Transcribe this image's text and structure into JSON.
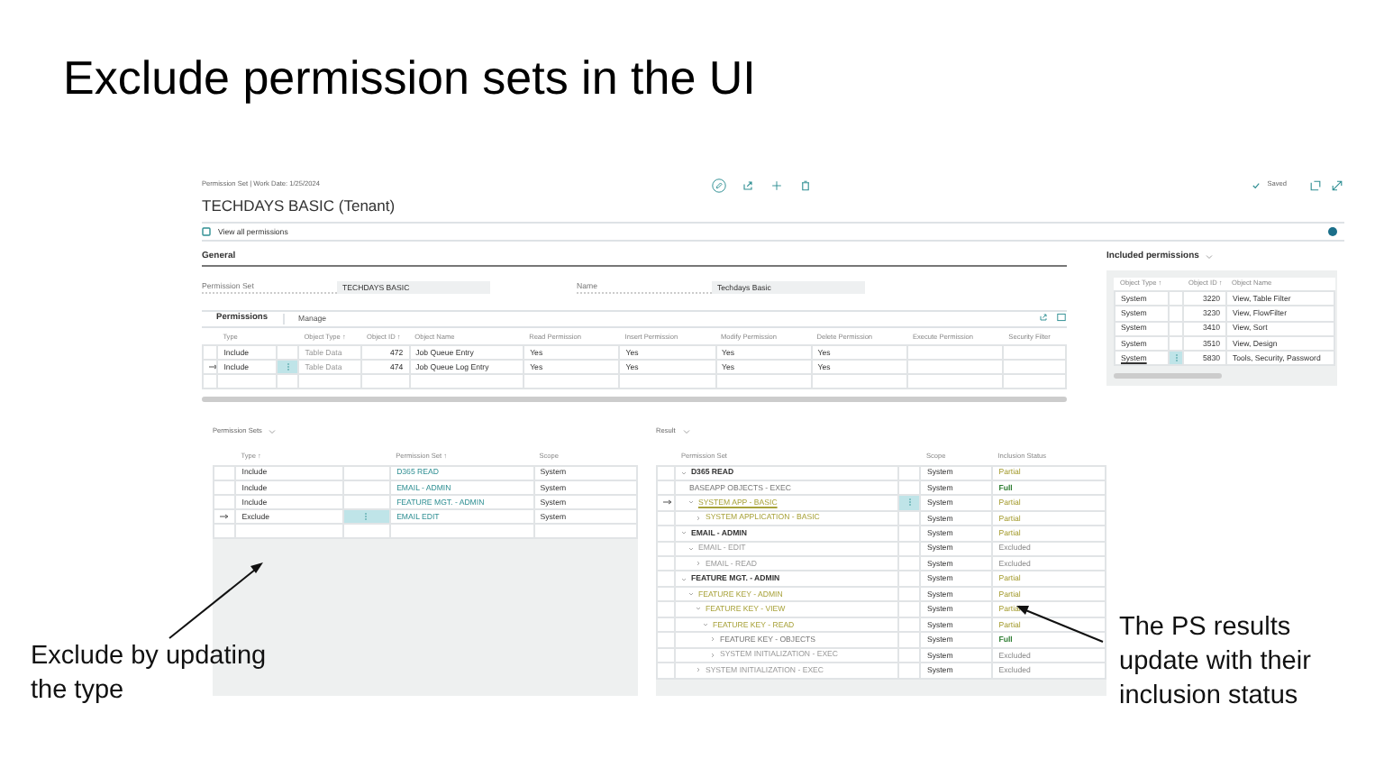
{
  "slide_title": "Exclude permission sets in the UI",
  "app": {
    "breadcrumb": "Permission Set | Work Date: 1/25/2024",
    "record_title": "TECHDAYS BASIC (Tenant)",
    "saved": "Saved",
    "view_all": "View all permissions"
  },
  "general": {
    "heading": "General",
    "fields": [
      {
        "label": "Permission Set",
        "value": "TECHDAYS BASIC"
      },
      {
        "label": "Name",
        "value": "Techdays Basic"
      }
    ]
  },
  "permissions": {
    "tabs": [
      {
        "label": "Permissions",
        "selected": true
      },
      {
        "label": "Manage",
        "selected": false
      }
    ],
    "columns": [
      "Type",
      "",
      "Object Type ↑",
      "Object ID ↑",
      "Object Name",
      "Read Permission",
      "Insert Permission",
      "Modify Permission",
      "Delete Permission",
      "Execute Permission",
      "Security Filter"
    ],
    "rows": [
      {
        "selected": false,
        "cells": [
          "Include",
          "",
          "Table Data",
          "472",
          "Job Queue Entry",
          "Yes",
          "Yes",
          "Yes",
          "Yes",
          "",
          ""
        ]
      },
      {
        "selected": true,
        "cells": [
          "Include",
          "",
          "Table Data",
          "474",
          "Job Queue Log Entry",
          "Yes",
          "Yes",
          "Yes",
          "Yes",
          "",
          ""
        ]
      }
    ]
  },
  "included_permissions": {
    "title": "Included permissions",
    "columns": [
      "Object Type ↑",
      "Object ID ↑",
      "Object Name"
    ],
    "rows": [
      {
        "selected": false,
        "cells": [
          "System",
          "3220",
          "View, Table Filter"
        ]
      },
      {
        "selected": false,
        "cells": [
          "System",
          "3230",
          "View, FlowFilter"
        ]
      },
      {
        "selected": false,
        "cells": [
          "System",
          "3410",
          "View, Sort"
        ]
      },
      {
        "selected": false,
        "cells": [
          "System",
          "3510",
          "View, Design"
        ]
      },
      {
        "selected": true,
        "cells": [
          "System",
          "5830",
          "Tools, Security, Password"
        ]
      }
    ]
  },
  "permission_sets": {
    "title": "Permission Sets",
    "columns": [
      "Type ↑",
      "Permission Set ↑",
      "Scope"
    ],
    "rows": [
      {
        "selected": false,
        "type": "Include",
        "permission_set": "D365 READ",
        "scope": "System"
      },
      {
        "selected": false,
        "type": "Include",
        "permission_set": "EMAIL - ADMIN",
        "scope": "System"
      },
      {
        "selected": false,
        "type": "Include",
        "permission_set": "FEATURE MGT. - ADMIN",
        "scope": "System"
      },
      {
        "selected": true,
        "type": "Exclude",
        "permission_set": "EMAIL EDIT",
        "scope": "System"
      }
    ]
  },
  "result": {
    "title": "Result",
    "columns": [
      "Permission Set",
      "Scope",
      "Inclusion Status"
    ],
    "rows": [
      {
        "name": "D365 READ",
        "scope": "System",
        "status": "Partial",
        "kind": "partial",
        "expanded": true,
        "selected": false,
        "children": [
          {
            "name": "BASEAPP OBJECTS - EXEC",
            "scope": "System",
            "status": "Full",
            "kind": "full",
            "selected": false
          },
          {
            "name": "SYSTEM APP - BASIC",
            "scope": "System",
            "status": "Partial",
            "kind": "partial",
            "expanded": true,
            "selected": true,
            "children": [
              {
                "name": "SYSTEM APPLICATION - BASIC",
                "scope": "System",
                "status": "Partial",
                "kind": "partial",
                "expanded": false,
                "selected": false
              }
            ]
          }
        ]
      },
      {
        "name": "EMAIL - ADMIN",
        "scope": "System",
        "status": "Partial",
        "kind": "partial",
        "expanded": true,
        "selected": false,
        "children": [
          {
            "name": "EMAIL - EDIT",
            "scope": "System",
            "status": "Excluded",
            "kind": "excluded",
            "expanded": true,
            "selected": false,
            "children": [
              {
                "name": "EMAIL - READ",
                "scope": "System",
                "status": "Excluded",
                "kind": "excluded",
                "expanded": false,
                "selected": false
              }
            ]
          }
        ]
      },
      {
        "name": "FEATURE MGT. - ADMIN",
        "scope": "System",
        "status": "Partial",
        "kind": "partial",
        "expanded": true,
        "selected": false,
        "children": [
          {
            "name": "FEATURE KEY - ADMIN",
            "scope": "System",
            "status": "Partial",
            "kind": "partial",
            "expanded": true,
            "selected": false,
            "children": [
              {
                "name": "FEATURE KEY - VIEW",
                "scope": "System",
                "status": "Partial",
                "kind": "partial",
                "expanded": true,
                "selected": false,
                "children": [
                  {
                    "name": "FEATURE KEY - READ",
                    "scope": "System",
                    "status": "Partial",
                    "kind": "partial",
                    "expanded": true,
                    "selected": false,
                    "children": [
                      {
                        "name": "FEATURE KEY - OBJECTS",
                        "scope": "System",
                        "status": "Full",
                        "kind": "full",
                        "expanded": false,
                        "selected": false
                      },
                      {
                        "name": "SYSTEM INITIALIZATION - EXEC",
                        "scope": "System",
                        "status": "Excluded",
                        "kind": "excluded",
                        "expanded": false,
                        "selected": false
                      }
                    ]
                  }
                ]
              },
              {
                "name": "SYSTEM INITIALIZATION - EXEC",
                "scope": "System",
                "status": "Excluded",
                "kind": "excluded",
                "expanded": false,
                "selected": false
              }
            ]
          }
        ]
      }
    ]
  },
  "callouts": [
    {
      "text": "Exclude by updating the type"
    },
    {
      "text": "The PS results update with their inclusion status"
    }
  ]
}
